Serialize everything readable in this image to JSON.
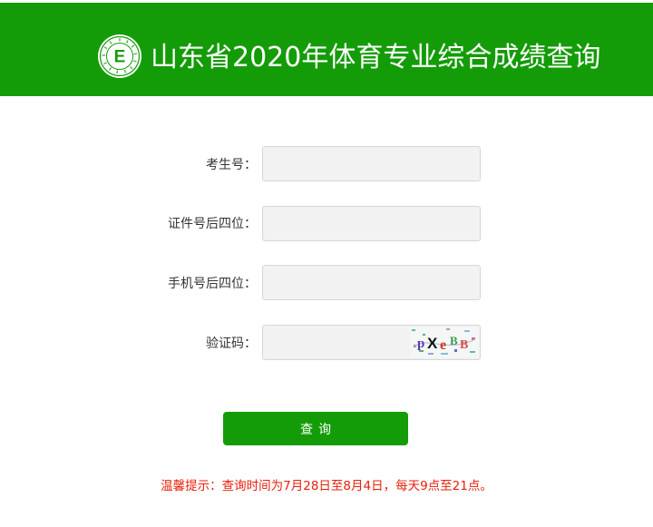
{
  "header": {
    "title": "山东省2020年体育专业综合成绩查询",
    "logo_letter": "E",
    "logo_icon": "sports-seal-logo"
  },
  "form": {
    "exam_number_label": "考生号：",
    "id_last4_label": "证件号后四位：",
    "phone_last4_label": "手机号后四位：",
    "captcha_label": "验证码：",
    "exam_number_value": "",
    "id_last4_value": "",
    "phone_last4_value": "",
    "captcha_value": "",
    "captcha_image_icon": "captcha-image"
  },
  "query_button_label": "查询",
  "notice": "温馨提示：查询时间为7月28日至8月4日，每天9点至21点。",
  "colors": {
    "brand_green": "#149c08",
    "notice_red": "#e8200c"
  }
}
